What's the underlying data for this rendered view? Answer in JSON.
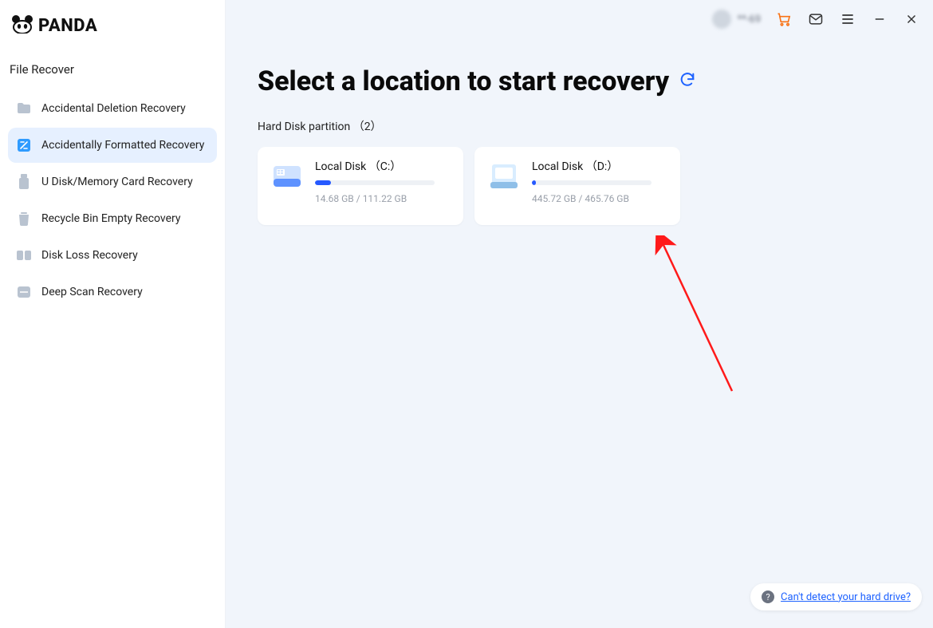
{
  "brand": {
    "name": "PANDA"
  },
  "titlebar": {
    "user_id": "**-69"
  },
  "sidebar": {
    "section": "File Recover",
    "items": [
      {
        "label": "Accidental Deletion Recovery",
        "icon": "folder"
      },
      {
        "label": "Accidentally Formatted Recovery",
        "icon": "format",
        "active": true
      },
      {
        "label": "U Disk/Memory Card Recovery",
        "icon": "usb"
      },
      {
        "label": "Recycle Bin Empty Recovery",
        "icon": "trash"
      },
      {
        "label": "Disk Loss Recovery",
        "icon": "disk"
      },
      {
        "label": "Deep Scan Recovery",
        "icon": "scan"
      }
    ]
  },
  "main": {
    "heading": "Select a location to start recovery",
    "subheading": "Hard Disk partition （2）",
    "partitions": [
      {
        "name": "Local Disk （C:）",
        "used": "14.68 GB",
        "total": "111.22 GB",
        "percent": 13
      },
      {
        "name": "Local Disk （D:）",
        "used": "445.72 GB",
        "total": "465.76 GB",
        "percent": 3
      }
    ]
  },
  "help": {
    "link": "Can't detect your hard drive?"
  }
}
